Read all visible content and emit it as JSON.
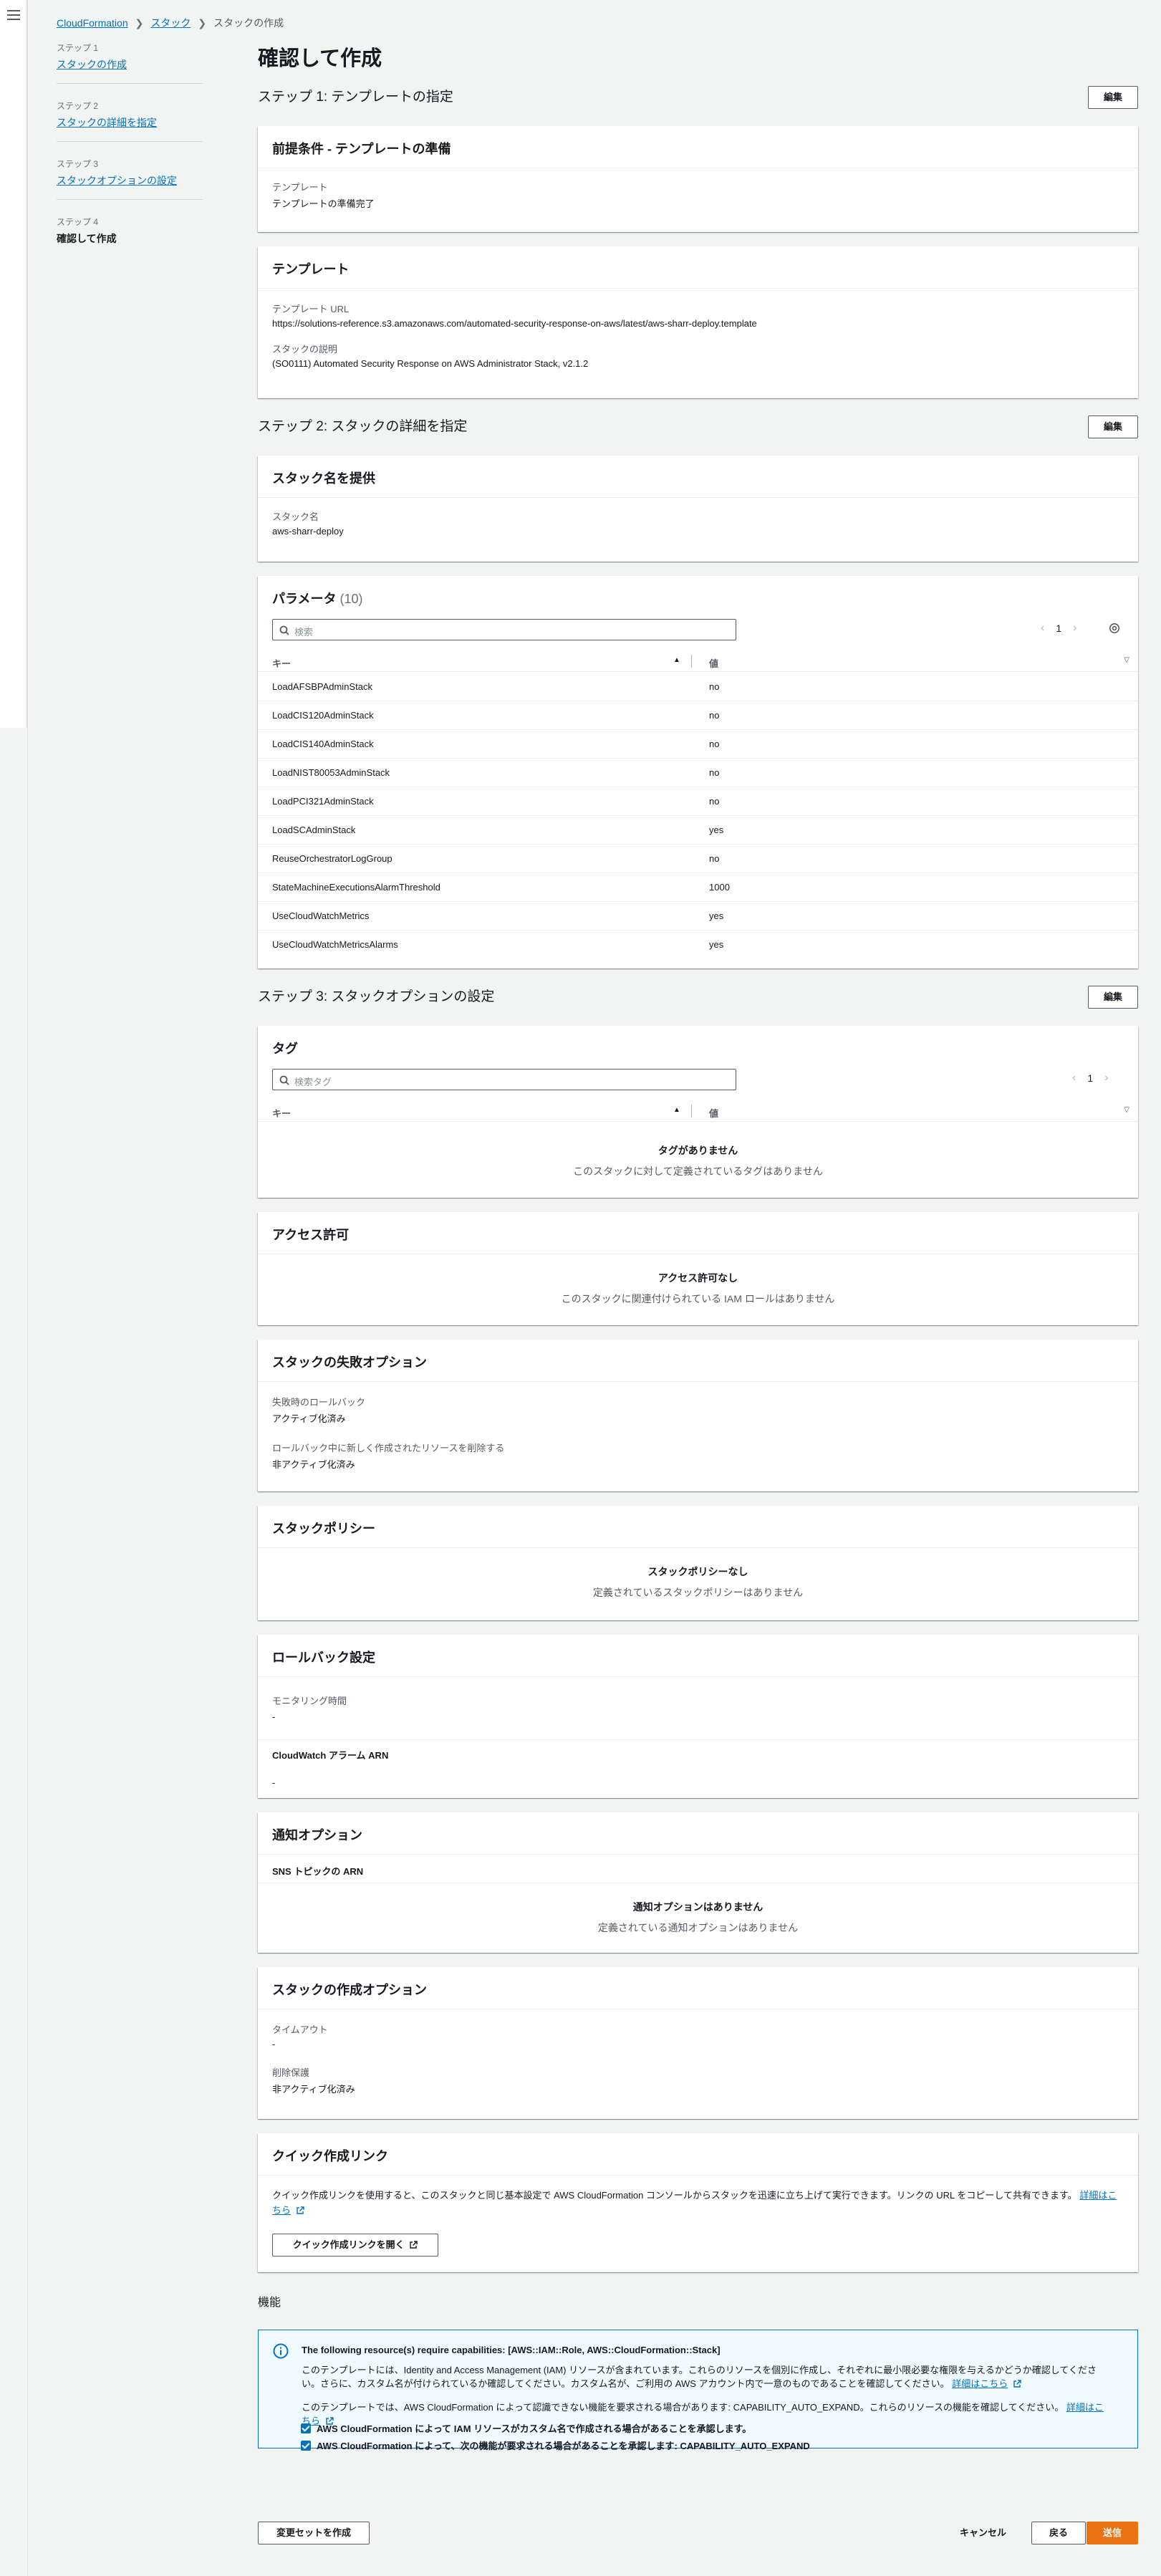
{
  "breadcrumb": [
    "CloudFormation",
    "スタック",
    "スタックの作成"
  ],
  "wizard": [
    {
      "num": "ステップ 1",
      "label": "スタックの作成"
    },
    {
      "num": "ステップ 2",
      "label": "スタックの詳細を指定"
    },
    {
      "num": "ステップ 3",
      "label": "スタックオプションの設定"
    },
    {
      "num": "ステップ 4",
      "label": "確認して作成"
    }
  ],
  "page_title": "確認して作成",
  "edit_label": "編集",
  "step1": {
    "title": "ステップ 1: テンプレートの指定",
    "prereq": {
      "title": "前提条件 - テンプレートの準備",
      "k": "テンプレート",
      "v": "テンプレートの準備完了"
    },
    "template": {
      "title": "テンプレート",
      "url_k": "テンプレート URL",
      "url_v": "https://solutions-reference.s3.amazonaws.com/automated-security-response-on-aws/latest/aws-sharr-deploy.template",
      "desc_k": "スタックの説明",
      "desc_v": "(SO0111) Automated Security Response on AWS Administrator Stack, v2.1.2"
    }
  },
  "step2": {
    "title": "ステップ 2: スタックの詳細を指定",
    "stackname": {
      "title": "スタック名を提供",
      "k": "スタック名",
      "v": "aws-sharr-deploy"
    },
    "params": {
      "title": "パラメータ",
      "count": "(10)",
      "search_placeholder": "検索",
      "page": "1",
      "col_key": "キー",
      "col_value": "値",
      "rows": [
        {
          "k": "LoadAFSBPAdminStack",
          "v": "no"
        },
        {
          "k": "LoadCIS120AdminStack",
          "v": "no"
        },
        {
          "k": "LoadCIS140AdminStack",
          "v": "no"
        },
        {
          "k": "LoadNIST80053AdminStack",
          "v": "no"
        },
        {
          "k": "LoadPCI321AdminStack",
          "v": "no"
        },
        {
          "k": "LoadSCAdminStack",
          "v": "yes"
        },
        {
          "k": "ReuseOrchestratorLogGroup",
          "v": "no"
        },
        {
          "k": "StateMachineExecutionsAlarmThreshold",
          "v": "1000"
        },
        {
          "k": "UseCloudWatchMetrics",
          "v": "yes"
        },
        {
          "k": "UseCloudWatchMetricsAlarms",
          "v": "yes"
        }
      ]
    }
  },
  "step3": {
    "title": "ステップ 3: スタックオプションの設定",
    "tags": {
      "title": "タグ",
      "search_placeholder": "検索タグ",
      "page": "1",
      "col_key": "キー",
      "col_value": "値",
      "empty_title": "タグがありません",
      "empty_sub": "このスタックに対して定義されているタグはありません"
    },
    "perms": {
      "title": "アクセス許可",
      "empty_title": "アクセス許可なし",
      "empty_sub": "このスタックに関連付けられている IAM ロールはありません"
    },
    "failure": {
      "title": "スタックの失敗オプション",
      "k1": "失敗時のロールバック",
      "v1": "アクティブ化済み",
      "k2": "ロールバック中に新しく作成されたリソースを削除する",
      "v2": "非アクティブ化済み"
    },
    "policy": {
      "title": "スタックポリシー",
      "empty_title": "スタックポリシーなし",
      "empty_sub": "定義されているスタックポリシーはありません"
    },
    "rollback": {
      "title": "ロールバック設定",
      "k1": "モニタリング時間",
      "v1": "-",
      "k2": "CloudWatch アラーム ARN",
      "v2": "-"
    },
    "notify": {
      "title": "通知オプション",
      "k": "SNS トピックの ARN",
      "empty_title": "通知オプションはありません",
      "empty_sub": "定義されている通知オプションはありません"
    },
    "creation": {
      "title": "スタックの作成オプション",
      "k1": "タイムアウト",
      "v1": "-",
      "k2": "削除保護",
      "v2": "非アクティブ化済み"
    },
    "quick": {
      "title": "クイック作成リンク",
      "text": "クイック作成リンクを使用すると、このスタックと同じ基本設定で AWS CloudFormation コンソールからスタックを迅速に立ち上げて実行できます。リンクの URL をコピーして共有できます。",
      "link": "詳細はこちら",
      "button": "クイック作成リンクを開く"
    }
  },
  "capabilities": {
    "section_title": "機能",
    "info_title": "The following resource(s) require capabilities: [AWS::IAM::Role, AWS::CloudFormation::Stack]",
    "text1": "このテンプレートには、Identity and Access Management (IAM) リソースが含まれています。これらのリソースを個別に作成し、それぞれに最小限必要な権限を与えるかどうか確認してください。さらに、カスタム名が付けられているか確認してください。カスタム名が、ご利用の AWS アカウント内で一意のものであることを確認してください。",
    "link1": "詳細はこちら",
    "text2": "このテンプレートでは、AWS CloudFormation によって認識できない機能を要求される場合があります: CAPABILITY_AUTO_EXPAND。これらのリソースの機能を確認してください。",
    "link2": "詳細はこちら",
    "cb1": "AWS CloudFormation によって IAM リソースがカスタム名で作成される場合があることを承認します。",
    "cb2": "AWS CloudFormation によって、次の機能が要求される場合があることを承認します: CAPABILITY_AUTO_EXPAND"
  },
  "footer": {
    "changeset": "変更セットを作成",
    "cancel": "キャンセル",
    "back": "戻る",
    "submit": "送信"
  },
  "colors": {
    "primary": "#ec7211",
    "link": "#0073bb",
    "info_bg": "#f1faff"
  }
}
